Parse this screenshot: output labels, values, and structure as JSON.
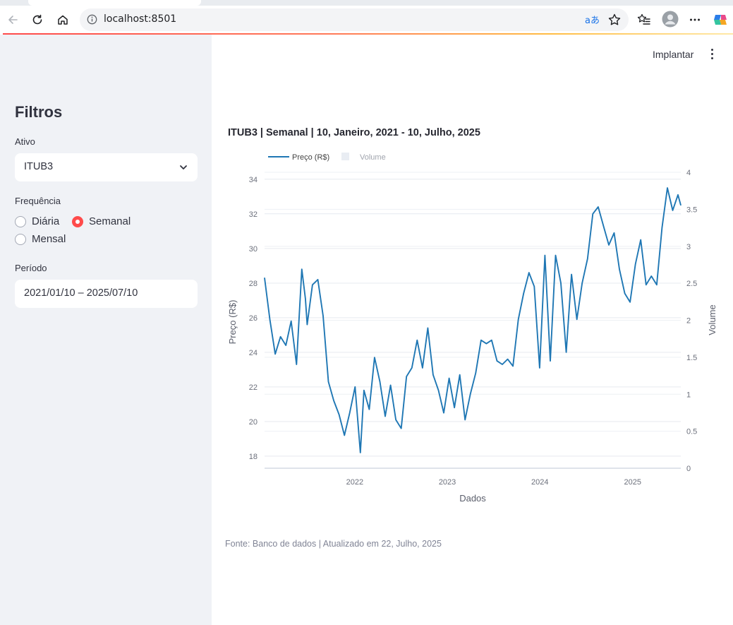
{
  "browser": {
    "url": "localhost:8501",
    "translate_glyph": "aあ"
  },
  "sidebar": {
    "title": "Filtros",
    "ativo_label": "Ativo",
    "ativo_value": "ITUB3",
    "frequencia_label": "Frequência",
    "frequencia_options": [
      "Diária",
      "Semanal",
      "Mensal"
    ],
    "frequencia_selected": "Semanal",
    "periodo_label": "Período",
    "periodo_value": "2021/01/10 – 2025/07/10"
  },
  "header": {
    "deploy_label": "Implantar"
  },
  "colors": {
    "accent": "#ff4b4b",
    "line": "#1f77b4",
    "sidebar_bg": "#f0f2f6"
  },
  "chart_data": {
    "type": "line",
    "title": "ITUB3 | Semanal | 10, Janeiro, 2021 - 10, Julho, 2025",
    "xlabel": "Dados",
    "ylabel": "Preço (R$)",
    "y2label": "Volume",
    "legend": [
      "Preço (R$)",
      "Volume"
    ],
    "legend_position": "top-left",
    "x_ticks": [
      "2022",
      "2023",
      "2024",
      "2025"
    ],
    "y_ticks": [
      18,
      20,
      22,
      24,
      26,
      28,
      30,
      32,
      34
    ],
    "y2_ticks": [
      "0",
      "0.5",
      "1",
      "1.5",
      "2",
      "2.5",
      "3",
      "3.5",
      "4"
    ],
    "ylim": [
      17.3,
      34.4
    ],
    "y2lim": [
      0,
      4
    ],
    "xlim": [
      "2021-01-10",
      "2025-07-10"
    ],
    "grid": true,
    "series": [
      {
        "name": "Preço (R$)",
        "x": [
          "2021-01-10",
          "2021-01-31",
          "2021-02-21",
          "2021-03-14",
          "2021-04-04",
          "2021-04-25",
          "2021-05-16",
          "2021-06-06",
          "2021-06-20",
          "2021-06-27",
          "2021-07-18",
          "2021-08-08",
          "2021-08-29",
          "2021-09-19",
          "2021-10-10",
          "2021-10-31",
          "2021-11-21",
          "2021-12-12",
          "2022-01-02",
          "2022-01-23",
          "2022-02-06",
          "2022-02-27",
          "2022-03-20",
          "2022-04-10",
          "2022-05-01",
          "2022-05-22",
          "2022-06-12",
          "2022-07-03",
          "2022-07-24",
          "2022-08-14",
          "2022-09-04",
          "2022-09-25",
          "2022-10-16",
          "2022-11-06",
          "2022-11-27",
          "2022-12-18",
          "2023-01-08",
          "2023-01-29",
          "2023-02-19",
          "2023-03-12",
          "2023-04-02",
          "2023-04-23",
          "2023-05-14",
          "2023-06-04",
          "2023-06-25",
          "2023-07-16",
          "2023-08-06",
          "2023-08-27",
          "2023-09-17",
          "2023-10-08",
          "2023-10-29",
          "2023-11-19",
          "2023-12-10",
          "2023-12-31",
          "2024-01-21",
          "2024-02-11",
          "2024-03-03",
          "2024-03-24",
          "2024-04-14",
          "2024-05-05",
          "2024-05-26",
          "2024-06-16",
          "2024-07-07",
          "2024-07-28",
          "2024-08-18",
          "2024-09-08",
          "2024-09-29",
          "2024-10-20",
          "2024-11-10",
          "2024-12-01",
          "2024-12-22",
          "2025-01-12",
          "2025-02-02",
          "2025-02-23",
          "2025-03-16",
          "2025-04-06",
          "2025-04-27",
          "2025-05-18",
          "2025-06-08",
          "2025-06-29",
          "2025-07-10"
        ],
        "values": [
          28.3,
          25.9,
          23.9,
          24.9,
          24.4,
          25.8,
          23.3,
          28.8,
          27.1,
          25.6,
          27.9,
          28.2,
          26.1,
          22.3,
          21.2,
          20.4,
          19.2,
          20.5,
          22.0,
          18.2,
          21.8,
          20.7,
          23.7,
          22.3,
          20.3,
          22.1,
          20.1,
          19.6,
          22.6,
          23.1,
          24.7,
          23.1,
          25.4,
          22.7,
          21.8,
          20.5,
          22.5,
          20.8,
          22.7,
          20.1,
          21.6,
          22.8,
          24.7,
          24.5,
          24.7,
          23.5,
          23.3,
          23.6,
          23.2,
          25.9,
          27.4,
          28.6,
          27.8,
          23.1,
          29.6,
          23.5,
          29.6,
          28.0,
          24.0,
          28.5,
          25.9,
          28.0,
          29.4,
          32.0,
          32.4,
          31.3,
          30.2,
          30.9,
          28.8,
          27.4,
          26.9,
          29.1,
          30.5,
          27.9,
          28.4,
          27.9,
          31.2,
          33.5,
          32.2,
          33.1,
          32.5
        ]
      },
      {
        "name": "Volume",
        "values": []
      }
    ]
  },
  "footnote": "Fonte: Banco de dados | Atualizado em 22, Julho, 2025"
}
